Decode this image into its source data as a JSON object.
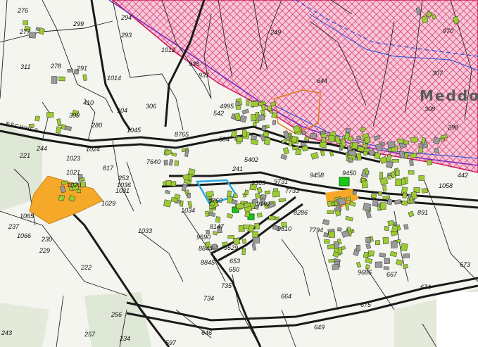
{
  "map": {
    "place_name": "Meddo",
    "street_name": "ESCHWEG",
    "colors": {
      "background": "#f4f5ef",
      "meadow": "#dfe8d6",
      "road": "#1a1a1a",
      "hatch": "#d4145a",
      "hatch_fill": "#f6c8d8",
      "building_green": "#9ccc32",
      "building_grey": "#9a9a9a",
      "orange_zone": "#f6a828",
      "blue_outline": "#27a9e1",
      "bright_green": "#18c718",
      "purple_line": "#7b2cbf",
      "blue_line": "#1f4fd8"
    },
    "parcel_labels": [
      {
        "text": "276"
      },
      {
        "text": "277"
      },
      {
        "text": "299"
      },
      {
        "text": "293"
      },
      {
        "text": "294"
      },
      {
        "text": "311"
      },
      {
        "text": "278"
      },
      {
        "text": "291"
      },
      {
        "text": "1012"
      },
      {
        "text": "1014"
      },
      {
        "text": "938"
      },
      {
        "text": "937"
      },
      {
        "text": "306"
      },
      {
        "text": "309"
      },
      {
        "text": "280"
      },
      {
        "text": "1045"
      },
      {
        "text": "104"
      },
      {
        "text": "410"
      },
      {
        "text": "244"
      },
      {
        "text": "221"
      },
      {
        "text": "1024"
      },
      {
        "text": "1023"
      },
      {
        "text": "1021"
      },
      {
        "text": "1020"
      },
      {
        "text": "817"
      },
      {
        "text": "253"
      },
      {
        "text": "1036"
      },
      {
        "text": "1031"
      },
      {
        "text": "1029"
      },
      {
        "text": "1065"
      },
      {
        "text": "237"
      },
      {
        "text": "1066"
      },
      {
        "text": "230"
      },
      {
        "text": "229"
      },
      {
        "text": "1033"
      },
      {
        "text": "222"
      },
      {
        "text": "584"
      },
      {
        "text": "542"
      },
      {
        "text": "4995"
      },
      {
        "text": "241"
      },
      {
        "text": "8765"
      },
      {
        "text": "9731"
      },
      {
        "text": "7733"
      },
      {
        "text": "9458"
      },
      {
        "text": "9450"
      },
      {
        "text": "8286"
      },
      {
        "text": "9610"
      },
      {
        "text": "7794"
      },
      {
        "text": "891"
      },
      {
        "text": "673"
      },
      {
        "text": "674"
      },
      {
        "text": "667"
      },
      {
        "text": "9686"
      },
      {
        "text": "675"
      },
      {
        "text": "664"
      },
      {
        "text": "649"
      },
      {
        "text": "734"
      },
      {
        "text": "735"
      },
      {
        "text": "650"
      },
      {
        "text": "653"
      },
      {
        "text": "8844"
      },
      {
        "text": "8845"
      },
      {
        "text": "9590"
      },
      {
        "text": "646"
      },
      {
        "text": "597"
      },
      {
        "text": "234"
      },
      {
        "text": "256"
      },
      {
        "text": "257"
      },
      {
        "text": "243"
      },
      {
        "text": "307"
      },
      {
        "text": "308"
      },
      {
        "text": "249"
      },
      {
        "text": "644"
      },
      {
        "text": "970"
      },
      {
        "text": "1058"
      },
      {
        "text": "442"
      },
      {
        "text": "298"
      },
      {
        "text": "1034"
      },
      {
        "text": "9529"
      },
      {
        "text": "7640"
      },
      {
        "text": "9760"
      },
      {
        "text": "8147"
      },
      {
        "text": "9363"
      },
      {
        "text": "9192"
      },
      {
        "text": "5402"
      }
    ]
  }
}
